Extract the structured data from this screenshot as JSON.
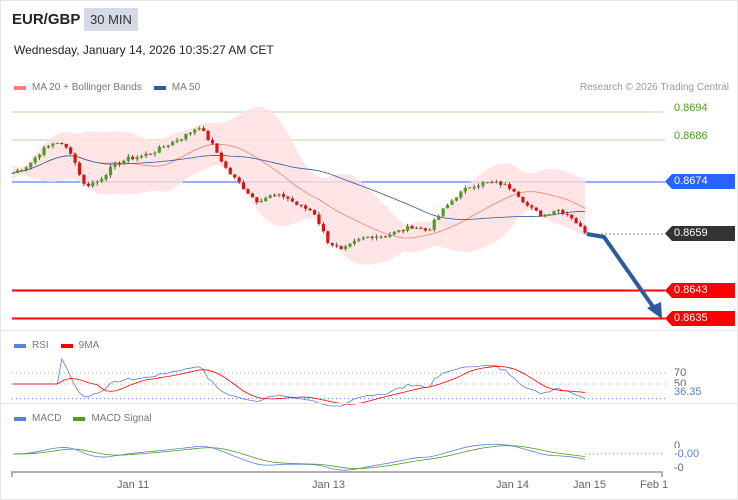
{
  "header": {
    "pair": "EUR/GBP",
    "timeframe": "30 MIN",
    "datetime": "Wednesday, January 14, 2026 10:35:27 AM CET"
  },
  "legend": {
    "ma20": "MA 20 + Bollinger Bands",
    "ma50": "MA 50",
    "credit": "Research © 2026 Trading Central"
  },
  "levels": [
    {
      "value": "0.8694",
      "color": "#4aa01e",
      "type": "text"
    },
    {
      "value": "0.8686",
      "color": "#4aa01e",
      "type": "text"
    },
    {
      "value": "0.8674",
      "color": "#2962ff",
      "type": "tag"
    },
    {
      "value": "0.8659",
      "color": "#333333",
      "type": "tag"
    },
    {
      "value": "0.8643",
      "color": "#ff0000",
      "type": "tag"
    },
    {
      "value": "0.8635",
      "color": "#ff0000",
      "type": "tag"
    }
  ],
  "rsi": {
    "label": "RSI",
    "ma_label": "9MA",
    "level70": "70",
    "level50": "50",
    "value": "36.35"
  },
  "macd": {
    "label": "MACD",
    "signal_label": "MACD Signal",
    "zero": "0",
    "value": "-0.00",
    "neg": "-0"
  },
  "xaxis": [
    "Jan 11",
    "Jan 13",
    "Jan 14",
    "Jan 15",
    "Feb 1"
  ],
  "chart_data": {
    "type": "candlestick",
    "price_keypoints": [
      0.86766,
      0.86786,
      0.86829,
      0.86857,
      0.86829,
      0.86729,
      0.86743,
      0.86786,
      0.86806,
      0.86814,
      0.86829,
      0.86851,
      0.86871,
      0.869,
      0.86843,
      0.86771,
      0.86729,
      0.86686,
      0.867,
      0.867,
      0.86671,
      0.86657,
      0.86571,
      0.86543,
      0.86571,
      0.86586,
      0.86586,
      0.866,
      0.86614,
      0.866,
      0.86657,
      0.867,
      0.86729,
      0.86737,
      0.86737,
      0.8672,
      0.86671,
      0.86643,
      0.86663,
      0.86643,
      0.86595
    ],
    "forecast_target": 0.8635
  }
}
